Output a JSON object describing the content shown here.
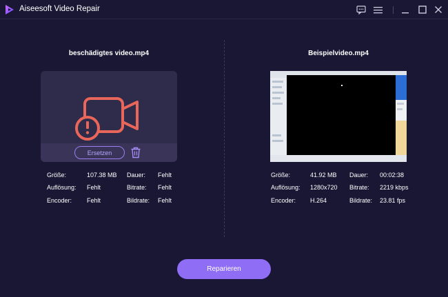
{
  "app": {
    "title": "Aiseesoft Video Repair"
  },
  "left": {
    "file_name": "beschädigtes video.mp4",
    "replace_label": "Ersetzen",
    "info": [
      {
        "label": "Größe:",
        "value": "107.38 MB",
        "label2": "Dauer:",
        "value2": "Fehlt"
      },
      {
        "label": "Auflösung:",
        "value": "Fehlt",
        "label2": "Bitrate:",
        "value2": "Fehlt"
      },
      {
        "label": "Encoder:",
        "value": "Fehlt",
        "label2": "Bildrate:",
        "value2": "Fehlt"
      }
    ]
  },
  "right": {
    "file_name": "Beispielvideo.mp4",
    "info": [
      {
        "label": "Größe:",
        "value": "41.92 MB",
        "label2": "Dauer:",
        "value2": "00:02:38"
      },
      {
        "label": "Auflösung:",
        "value": "1280x720",
        "label2": "Bitrate:",
        "value2": "2219 kbps"
      },
      {
        "label": "Encoder:",
        "value": "H.264",
        "label2": "Bildrate:",
        "value2": "23.81 fps"
      }
    ]
  },
  "repair_label": "Reparieren",
  "icons": {
    "logo": "play-logo-icon",
    "feedback": "chat-bubble-icon",
    "menu": "hamburger-menu-icon",
    "minimize": "minimize-icon",
    "maximize": "maximize-icon",
    "close": "close-icon",
    "broken_video": "broken-video-camera-icon",
    "trash": "trash-icon"
  },
  "colors": {
    "background": "#1a1734",
    "accent": "#8f6df5",
    "broken_icon": "#e8675a",
    "card": "#2f2b4a"
  }
}
